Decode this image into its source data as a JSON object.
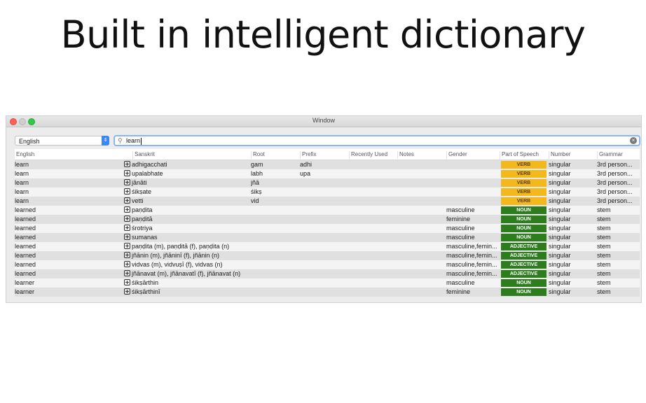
{
  "headline": "Built in intelligent dictionary",
  "window": {
    "title": "Window"
  },
  "toolbar": {
    "language": "English",
    "search_value": "learn"
  },
  "columns": [
    "English",
    "Sanskrit",
    "Root",
    "Prefix",
    "Recently Used",
    "Notes",
    "Gender",
    "Part of Speech",
    "Number",
    "Grammar"
  ],
  "rows": [
    {
      "english": "learn",
      "sanskrit": "adhigacchati",
      "root": "gam",
      "prefix": "adhi",
      "gender": "",
      "pos": "VERB",
      "number": "singular",
      "grammar": "3rd person..."
    },
    {
      "english": "learn",
      "sanskrit": "upalabhate",
      "root": "labh",
      "prefix": "upa",
      "gender": "",
      "pos": "VERB",
      "number": "singular",
      "grammar": "3rd person..."
    },
    {
      "english": "learn",
      "sanskrit": "jānāti",
      "root": "jñā",
      "prefix": "",
      "gender": "",
      "pos": "VERB",
      "number": "singular",
      "grammar": "3rd person..."
    },
    {
      "english": "learn",
      "sanskrit": "śikṣate",
      "root": "śikṣ",
      "prefix": "",
      "gender": "",
      "pos": "VERB",
      "number": "singular",
      "grammar": "3rd person..."
    },
    {
      "english": "learn",
      "sanskrit": "vetti",
      "root": "vid",
      "prefix": "",
      "gender": "",
      "pos": "VERB",
      "number": "singular",
      "grammar": "3rd person..."
    },
    {
      "english": "learned",
      "sanskrit": "paṇḍita",
      "root": "",
      "prefix": "",
      "gender": "masculine",
      "pos": "NOUN",
      "number": "singular",
      "grammar": "stem"
    },
    {
      "english": "learned",
      "sanskrit": "paṇḍitā",
      "root": "",
      "prefix": "",
      "gender": "feminine",
      "pos": "NOUN",
      "number": "singular",
      "grammar": "stem"
    },
    {
      "english": "learned",
      "sanskrit": "śrotriya",
      "root": "",
      "prefix": "",
      "gender": "masculine",
      "pos": "NOUN",
      "number": "singular",
      "grammar": "stem"
    },
    {
      "english": "learned",
      "sanskrit": "sumanas",
      "root": "",
      "prefix": "",
      "gender": "masculine",
      "pos": "NOUN",
      "number": "singular",
      "grammar": "stem"
    },
    {
      "english": "learned",
      "sanskrit": "paṇḍita (m), paṇḍitā (f), paṇḍita (n)",
      "root": "",
      "prefix": "",
      "gender": "masculine,femin...",
      "pos": "ADJECTIVE",
      "number": "singular",
      "grammar": "stem"
    },
    {
      "english": "learned",
      "sanskrit": "jñānin (m), jñāninī (f), jñānin (n)",
      "root": "",
      "prefix": "",
      "gender": "masculine,femin...",
      "pos": "ADJECTIVE",
      "number": "singular",
      "grammar": "stem"
    },
    {
      "english": "learned",
      "sanskrit": "vidvas (m), vidvuṣī (f), vidvas (n)",
      "root": "",
      "prefix": "",
      "gender": "masculine,femin...",
      "pos": "ADJECTIVE",
      "number": "singular",
      "grammar": "stem"
    },
    {
      "english": "learned",
      "sanskrit": "jñānavat (m), jñānavatī (f), jñānavat (n)",
      "root": "",
      "prefix": "",
      "gender": "masculine,femin...",
      "pos": "ADJECTIVE",
      "number": "singular",
      "grammar": "stem"
    },
    {
      "english": "learner",
      "sanskrit": "śikṣārthin",
      "root": "",
      "prefix": "",
      "gender": "masculine",
      "pos": "NOUN",
      "number": "singular",
      "grammar": "stem"
    },
    {
      "english": "learner",
      "sanskrit": "śikṣārthinī",
      "root": "",
      "prefix": "",
      "gender": "feminine",
      "pos": "NOUN",
      "number": "singular",
      "grammar": "stem"
    }
  ],
  "colors": {
    "verb_badge": "#f3b81b",
    "noun_badge": "#2d7d1f",
    "adjective_badge": "#2d7d1f",
    "accent": "#3b88f5"
  }
}
